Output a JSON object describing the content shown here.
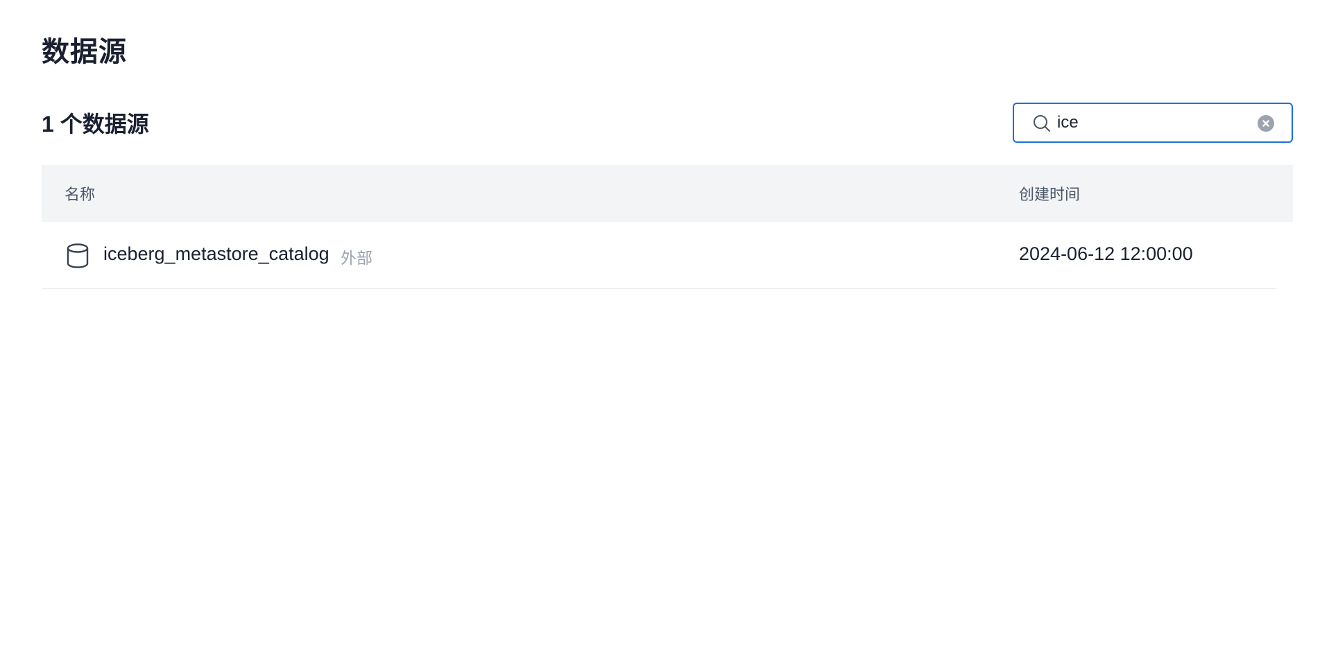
{
  "page": {
    "title": "数据源"
  },
  "toolbar": {
    "count_label": "1 个数据源",
    "search": {
      "value": "ice",
      "icon": "search-icon",
      "clear_icon": "clear-icon"
    }
  },
  "table": {
    "columns": [
      "名称",
      "创建时间"
    ],
    "rows": [
      {
        "icon": "database-icon",
        "name": "iceberg_metastore_catalog",
        "tag": "外部",
        "created_at": "2024-06-12 12:00:00"
      }
    ]
  },
  "colors": {
    "accent": "#1e6fd9",
    "header_bg": "#f2f4f6",
    "muted_text": "#9ca3af"
  }
}
